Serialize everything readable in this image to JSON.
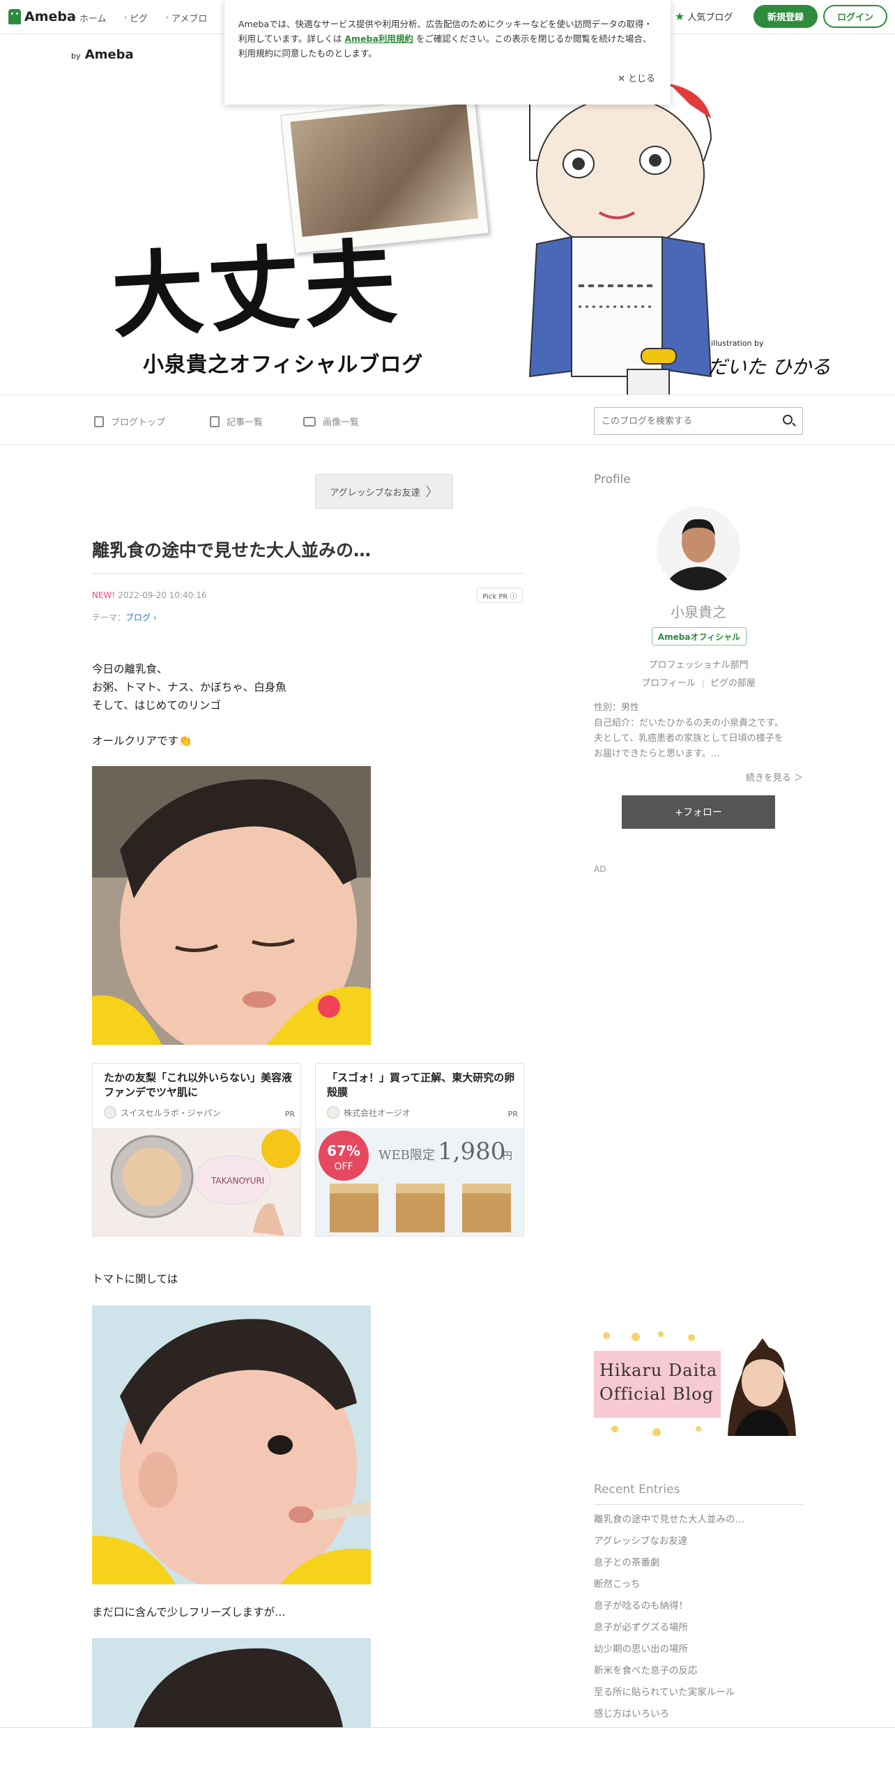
{
  "topbar": {
    "logo": "Ameba",
    "nav": [
      "ホーム",
      "ピグ",
      "アメブロ"
    ],
    "popular": "人気ブログ",
    "signup": "新規登録",
    "login": "ログイン"
  },
  "cookie": {
    "text1": "Amebaでは、快適なサービス提供や利用分析、広告配信のためにクッキーなどを使い訪問データの取得・利用しています。詳しくは",
    "link": "Ameba利用規約",
    "text2": "をご確認ください。この表示を閉じるか閲覧を続けた場合、利用規約に同意したものとします。",
    "close": "とじる"
  },
  "header": {
    "by": "by",
    "brand": "Ameba",
    "title": "大丈夫",
    "subtitle": "小泉貴之オフィシャルブログ",
    "illustration_by": "illustration by",
    "artist": "だいた ひかる"
  },
  "blognav": {
    "top": "ブログトップ",
    "list": "記事一覧",
    "images": "画像一覧",
    "search_placeholder": "このブログを検索する"
  },
  "entry": {
    "prev": "アグレッシブなお友達",
    "title": "離乳食の途中で見せた大人並みの…",
    "new": "NEW!",
    "datetime": "2022-09-20 10:40:16",
    "pickpr": "Pick PR ⓘ",
    "theme_label": "テーマ：",
    "theme": "ブログ",
    "para1": [
      "今日の離乳食、",
      "お粥、トマト、ナス、かぼちゃ、白身魚",
      "そして、はじめてのリンゴ"
    ],
    "para2": "オールクリアです👏",
    "para3": "トマトに関しては",
    "para4": "まだ口に含んで少しフリーズしますが…"
  },
  "ads": [
    {
      "title": "たかの友梨「これ以外いらない」美容液ファンデでツヤ肌に",
      "advertiser": "スイスセルラボ・ジャパン",
      "pr": "PR",
      "brand": "TAKANOYURI"
    },
    {
      "title": "「スゴォ！」買って正解、東大研究の卵殻膜",
      "advertiser": "株式会社オージオ",
      "pr": "PR",
      "discount": "67%",
      "discount_sub": "OFF",
      "price_label": "WEB限定",
      "price": "1,980",
      "price_unit": "円"
    }
  ],
  "sidebar": {
    "profile_heading": "Profile",
    "name": "小泉貴之",
    "badge": "Amebaオフィシャル",
    "department": "プロフェッショナル部門",
    "link_profile": "プロフィール",
    "link_pigg": "ピグの部屋",
    "info": [
      "性別：男性",
      "自己紹介：だいたひかるの夫の小泉貴之です。",
      "夫として、乳癌患者の家族として日頃の様子を",
      "お届けできたらと思います。…"
    ],
    "more": "続きを見る ＞",
    "follow": "+フォロー",
    "ad": "AD",
    "banner": {
      "line1": "Hikaru Daita",
      "line2": "Official Blog"
    },
    "recent_heading": "Recent Entries",
    "recent": [
      "離乳食の途中で見せた大人並みの…",
      "アグレッシブなお友達",
      "息子との茶番劇",
      "断然こっち",
      "息子が唸るのも納得！",
      "息子が必ずグズる場所",
      "幼少期の思い出の場所",
      "新米を食べた息子の反応",
      "至る所に貼られていた実家ルール",
      "感じ方はいろいろ"
    ]
  }
}
